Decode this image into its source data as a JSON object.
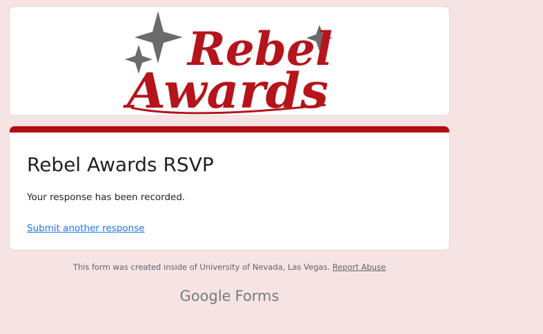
{
  "header": {
    "logo_text": "Rebel Awards"
  },
  "form": {
    "title": "Rebel Awards RSVP",
    "confirmation": "Your response has been recorded.",
    "another_response_link": "Submit another response"
  },
  "footer": {
    "created_note": "This form was created inside of University of Nevada, Las Vegas.",
    "report_abuse": "Report Abuse",
    "brand_google": "Google",
    "brand_forms": "Forms"
  },
  "colors": {
    "page_background": "#f6e4e4",
    "accent": "#b20d10",
    "link": "#1a73e8",
    "logo_red": "#b5141b",
    "sparkle_gray": "#6b6b6b"
  },
  "icons": {
    "sparkles": "four-point-star-icon"
  }
}
